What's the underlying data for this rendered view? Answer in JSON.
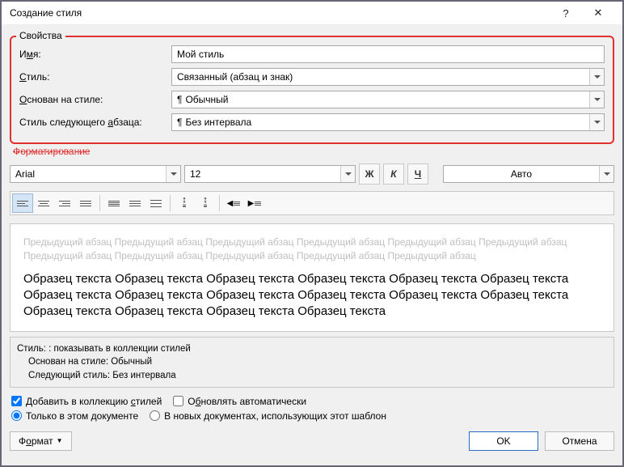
{
  "title": "Создание стиля",
  "properties": {
    "legend": "Свойства",
    "name_label_pre": "И",
    "name_label_u": "м",
    "name_label_post": "я:",
    "name_value": "Мой стиль",
    "type_label_pre": "",
    "type_label_u": "С",
    "type_label_post": "тиль:",
    "type_value": "Связанный (абзац и знак)",
    "based_label_pre": "",
    "based_label_u": "О",
    "based_label_post": "снован на стиле:",
    "based_value": "Обычный",
    "next_label_pre": "Стиль следующего ",
    "next_label_u": "а",
    "next_label_post": "бзаца:",
    "next_value": "Без интервала"
  },
  "formatting_label": "Форматирование",
  "toolbar": {
    "font": "Arial",
    "size": "12",
    "bold": "Ж",
    "italic": "К",
    "underline": "Ч",
    "color": "Авто"
  },
  "preview": {
    "ghost": "Предыдущий абзац Предыдущий абзац Предыдущий абзац Предыдущий абзац Предыдущий абзац Предыдущий абзац Предыдущий абзац Предыдущий абзац Предыдущий абзац Предыдущий абзац Предыдущий абзац",
    "sample": "Образец текста Образец текста Образец текста Образец текста Образец текста Образец текста Образец текста Образец текста Образец текста Образец текста Образец текста Образец текста Образец текста Образец текста Образец текста Образец текста"
  },
  "description": {
    "line1": "Стиль: : показывать в коллекции стилей",
    "line2": "Основан на стиле: Обычный",
    "line3": "Следующий стиль: Без интервала"
  },
  "checks": {
    "add_pre": "Добавить в коллекцию ",
    "add_u": "с",
    "add_post": "тилей",
    "auto_pre": "О",
    "auto_u": "б",
    "auto_post": "новлять автоматически",
    "doc_only": "Только в этом документе",
    "new_docs": "В новых документах, использующих этот шаблон"
  },
  "footer": {
    "format_pre": "Ф",
    "format_u": "о",
    "format_post": "рмат",
    "ok": "OK",
    "cancel": "Отмена"
  }
}
